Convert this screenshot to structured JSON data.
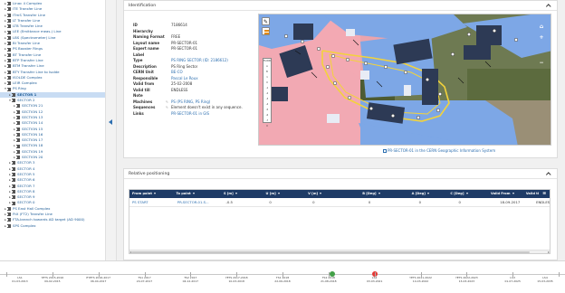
{
  "tree": {
    "items": [
      {
        "label": "Linac 4 Complex",
        "depth": 0,
        "toggle": "▸"
      },
      {
        "label": "ITE Transfer Line",
        "depth": 0,
        "toggle": "▸"
      },
      {
        "label": "ITmS Transfer Line",
        "depth": 0,
        "toggle": "▸"
      },
      {
        "label": "LT Transfer Line",
        "depth": 0,
        "toggle": "▸"
      },
      {
        "label": "LTB Transfer Line",
        "depth": 0,
        "toggle": "▸"
      },
      {
        "label": "LEE (Emittance meas.) Line",
        "depth": 0,
        "toggle": "▸"
      },
      {
        "label": "LBS (Spectrometer) Line",
        "depth": 0,
        "toggle": "▸"
      },
      {
        "label": "BI Transfer Line",
        "depth": 0,
        "toggle": "▸"
      },
      {
        "label": "PS Booster Rings",
        "depth": 0,
        "toggle": "▸"
      },
      {
        "label": "BT Transfer Line",
        "depth": 0,
        "toggle": "▸"
      },
      {
        "label": "BTP Transfer Line",
        "depth": 0,
        "toggle": "▸"
      },
      {
        "label": "BTM Transfer Line",
        "depth": 0,
        "toggle": "▸"
      },
      {
        "label": "BTY Transfer Line to Isolde",
        "depth": 0,
        "toggle": "▸"
      },
      {
        "label": "ISOLDE Complex",
        "depth": 0,
        "toggle": "▸"
      },
      {
        "label": "LEIR Complex",
        "depth": 0,
        "toggle": "▸"
      },
      {
        "label": "PS Ring",
        "depth": 0,
        "toggle": "▾"
      },
      {
        "label": "SECTOR 1",
        "depth": 1,
        "toggle": "▸",
        "selected": true
      },
      {
        "label": "SECTOR 2",
        "depth": 1,
        "toggle": "▾"
      },
      {
        "label": "SECTION 21",
        "depth": 2,
        "toggle": "▸"
      },
      {
        "label": "SECTION 12",
        "depth": 2,
        "toggle": "▸"
      },
      {
        "label": "SECTION 13",
        "depth": 2,
        "toggle": "▸"
      },
      {
        "label": "SECTION 14",
        "depth": 2,
        "toggle": "▸"
      },
      {
        "label": "SECTION 15",
        "depth": 2,
        "toggle": "▸"
      },
      {
        "label": "SECTION 16",
        "depth": 2,
        "toggle": "▸"
      },
      {
        "label": "SECTION 17",
        "depth": 2,
        "toggle": "▸"
      },
      {
        "label": "SECTION 18",
        "depth": 2,
        "toggle": "▸"
      },
      {
        "label": "SECTION 19",
        "depth": 2,
        "toggle": "▸"
      },
      {
        "label": "SECTION 20",
        "depth": 2,
        "toggle": "▸"
      },
      {
        "label": "SECTOR 3",
        "depth": 1,
        "toggle": "▸"
      },
      {
        "label": "SECTOR 4",
        "depth": 1,
        "toggle": "▸"
      },
      {
        "label": "SECTOR 5",
        "depth": 1,
        "toggle": "▸"
      },
      {
        "label": "SECTOR 6",
        "depth": 1,
        "toggle": "▸"
      },
      {
        "label": "SECTOR 7",
        "depth": 1,
        "toggle": "▸"
      },
      {
        "label": "SECTOR 8",
        "depth": 1,
        "toggle": "▸"
      },
      {
        "label": "SECTOR 9",
        "depth": 1,
        "toggle": "▸"
      },
      {
        "label": "SECTOR 0",
        "depth": 1,
        "toggle": "▸"
      },
      {
        "label": "PS East Hall Complex",
        "depth": 0,
        "toggle": "▸"
      },
      {
        "label": "FtX (FT2) Transfer Line",
        "depth": 0,
        "toggle": "▸"
      },
      {
        "label": "FTA-branch towards AD target (AD 9000)",
        "depth": 0,
        "toggle": "▸"
      },
      {
        "label": "SPS Complex",
        "depth": 0,
        "toggle": "▸"
      }
    ]
  },
  "identification": {
    "title": "Identification",
    "props": [
      {
        "key": "ID",
        "value": "7186614",
        "link": false
      },
      {
        "key": "Hierarchy",
        "value": "",
        "link": false
      },
      {
        "key": "Naming Format",
        "value": "FREE",
        "link": false
      },
      {
        "key": "Layout name",
        "value": "PR-SECTOR-01",
        "link": false
      },
      {
        "key": "Expert name",
        "value": "PR-SECTOR-01",
        "link": false
      },
      {
        "key": "Label",
        "value": "",
        "link": false
      },
      {
        "key": "Type",
        "value": "PS RING SECTOR (ID: 2186612)",
        "link": true
      },
      {
        "key": "Description",
        "value": "PS Ring Sector",
        "link": false
      },
      {
        "key": "CERN Unit",
        "value": "BE-CO",
        "link": true
      },
      {
        "key": "Responsible",
        "value": "Pascal Le Roux",
        "link": true
      },
      {
        "key": "Valid from",
        "value": "25-02-2008",
        "link": false
      },
      {
        "key": "Valid till",
        "value": "ENDLESS",
        "link": false
      },
      {
        "key": "Note",
        "value": "",
        "link": false
      },
      {
        "key": "Machines",
        "value": "PS (PS RING, PS Ring)",
        "link": true,
        "edit": true
      },
      {
        "key": "Sequences",
        "value": "Element doesn't exist in any sequence.",
        "link": false,
        "edit": true
      },
      {
        "key": "Links",
        "value": "PR-SECTOR-01 in GIS",
        "link": true
      }
    ],
    "map_caption": "PR-SECTOR-01 in the CERN Geographic Information System",
    "floor_panel": {
      "title": "FLOOR",
      "levels": [
        "A",
        "B",
        "1",
        "0",
        "-1",
        "-2",
        "-3",
        "-4",
        "-5",
        "-6",
        "-7"
      ],
      "u_label": "U"
    },
    "zoom": {
      "up": "▲",
      "plus": "+",
      "minus": "−",
      "home": "⌂"
    }
  },
  "relative_positioning": {
    "title": "Relative positioning",
    "columns": [
      "From point",
      "To point",
      "S [m]",
      "U [m]",
      "V [m]",
      "B [Deg]",
      "A [Deg]",
      "C [Deg]",
      "Valid From",
      "Valid till"
    ],
    "menu_icon": "≡",
    "rows": [
      [
        "PS START",
        "PR-SECTOR-01.S...",
        "-0.5",
        "0",
        "0",
        "0",
        "0",
        "0",
        "18-09-2017",
        "ENDLESS"
      ]
    ]
  },
  "timeline": {
    "labels": [
      {
        "l1": "LS1",
        "l2": "01-03-2013"
      },
      {
        "l1": "YETS 2015-2016",
        "l2": "09-02-2015"
      },
      {
        "l1": "EYETS 2016-2017",
        "l2": "06-04-2017"
      },
      {
        "l1": "TS1 2017",
        "l2": "24-07-2017"
      },
      {
        "l1": "TS2 2017",
        "l2": "04-12-2017"
      },
      {
        "l1": "YETS 2017-2018",
        "l2": "10-03-2018"
      },
      {
        "l1": "TS1 2018",
        "l2": "22-06-2018"
      },
      {
        "l1": "TS2 2018",
        "l2": "21-08-2018"
      },
      {
        "l1": "LS2",
        "l2": "03-03-2021"
      },
      {
        "l1": "YETS 2021-2022",
        "l2": "14-03-2022"
      },
      {
        "l1": "YETS 2022-2023",
        "l2": "13-03-2023"
      },
      {
        "l1": "LS3",
        "l2": "01-07-2025"
      },
      {
        "l1": "LS4",
        "l2": "15-03-2035"
      }
    ],
    "colors": {
      "green": "#43a047",
      "red": "#e53935"
    }
  },
  "colors": {
    "accent": "#2d6fb0",
    "table_header": "#1e3b66",
    "selected_row": "#c8dcf3"
  }
}
